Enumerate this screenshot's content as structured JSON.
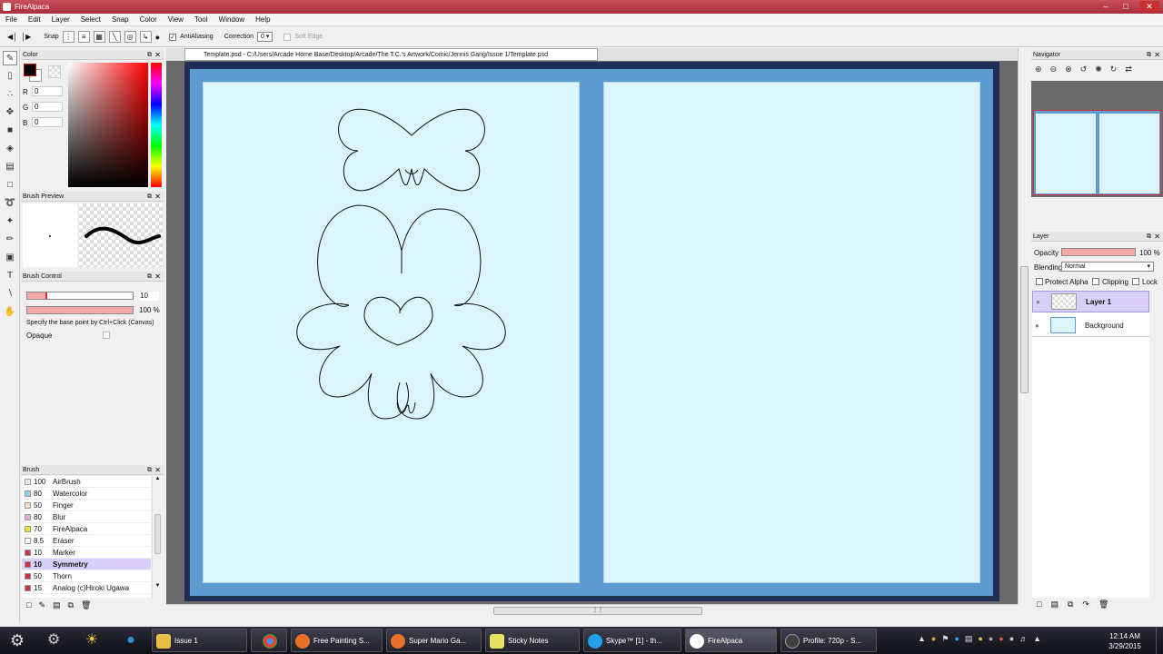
{
  "window": {
    "title": "FireAlpaca",
    "min": "–",
    "max": "□",
    "close": "✕"
  },
  "menu": [
    "File",
    "Edit",
    "Layer",
    "Select",
    "Snap",
    "Color",
    "View",
    "Tool",
    "Window",
    "Help"
  ],
  "toolbar": {
    "snap_label": "Snap",
    "antialiasing_label": "AntiAliasing",
    "correction_label": "Correction",
    "correction_value": "0",
    "soft_edge_label": "Soft Edge"
  },
  "color_panel": {
    "title": "Color",
    "r_label": "R",
    "r_value": "0",
    "g_label": "G",
    "g_value": "0",
    "b_label": "B",
    "b_value": "0",
    "primary_color": "#000000",
    "accent": "#ff0000"
  },
  "brush_preview": {
    "title": "Brush Preview"
  },
  "brush_control": {
    "title": "Brush Control",
    "size_value": "10",
    "opacity_value": "100 %",
    "hint": "Specify the base point by Ctrl+Click (Canvas)",
    "opaque_label": "Opaque"
  },
  "brush_panel": {
    "title": "Brush",
    "items": [
      {
        "size": "100",
        "name": "AirBrush",
        "color": "#e8e8e8"
      },
      {
        "size": "80",
        "name": "Watercolor",
        "color": "#7fd8f0"
      },
      {
        "size": "50",
        "name": "Finger",
        "color": "#f6e0c8"
      },
      {
        "size": "80",
        "name": "Blur",
        "color": "#e8a8d8"
      },
      {
        "size": "70",
        "name": "FireAlpaca",
        "color": "#e8e020"
      },
      {
        "size": "8.5",
        "name": "Eraser",
        "color": "#ffffff"
      },
      {
        "size": "10",
        "name": "Marker",
        "color": "#d03040"
      },
      {
        "size": "10",
        "name": "Symmetry",
        "color": "#d03040",
        "selected": true
      },
      {
        "size": "50",
        "name": "Thorn",
        "color": "#d03040"
      },
      {
        "size": "15",
        "name": "Analog (c)Hiroki Ugawa",
        "color": "#d03040"
      }
    ]
  },
  "document": {
    "tab_title": "Template.psd - C:/Users/Arcade Home Base/Desktop/Arcade/The T.C.'s Artwork/Comic/Jennis Gang/Issue 1/Template.psd"
  },
  "navigator": {
    "title": "Navigator"
  },
  "layer_panel": {
    "title": "Layer",
    "opacity_label": "Opacity",
    "opacity_value": "100 %",
    "blending_label": "Blending",
    "blending_value": "Normal",
    "protect_alpha_label": "Protect Alpha",
    "clipping_label": "Clipping",
    "lock_label": "Lock",
    "layers": [
      {
        "name": "Layer 1",
        "selected": true
      },
      {
        "name": "Background",
        "selected": false
      }
    ]
  },
  "taskbar": {
    "tasks": [
      {
        "label": "Issue 1",
        "color": "#e8c048"
      },
      {
        "label": "",
        "color": "#e84030"
      },
      {
        "label": "Free Painting S...",
        "color": "#e8702a"
      },
      {
        "label": "Super Mario Ga...",
        "color": "#e8702a"
      },
      {
        "label": "Sticky Notes",
        "color": "#e8e060"
      },
      {
        "label": "Skype™ [1] - th...",
        "color": "#20a0e8"
      },
      {
        "label": "FireAlpaca",
        "color": "#ffffff"
      },
      {
        "label": "Profile: 720p - S...",
        "color": "#404040"
      }
    ],
    "time": "12:14 AM",
    "date": "3/29/2015"
  }
}
